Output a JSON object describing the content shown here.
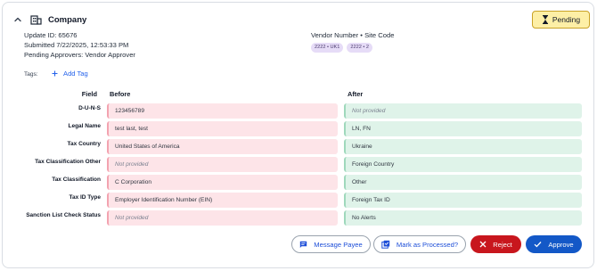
{
  "header": {
    "title": "Company",
    "status": "Pending"
  },
  "meta": {
    "update_id": "Update ID: 65676",
    "submitted": "Submitted 7/22/2025, 12:53:33 PM",
    "pending_approvers": "Pending Approvers: Vendor Approver"
  },
  "vendor": {
    "label": "Vendor Number • Site Code",
    "chips": [
      "2222 • UK1",
      "2222 • 2"
    ]
  },
  "tags": {
    "label": "Tags:",
    "add_label": "Add Tag"
  },
  "table": {
    "headers": {
      "field": "Field",
      "before": "Before",
      "after": "After"
    },
    "rows": [
      {
        "field": "D-U-N-S",
        "before": "123456789",
        "after": "Not provided"
      },
      {
        "field": "Legal Name",
        "before": "test last, test",
        "after": "LN, FN"
      },
      {
        "field": "Tax Country",
        "before": "United States of America",
        "after": "Ukraine"
      },
      {
        "field": "Tax Classification Other",
        "before": "Not provided",
        "after": "Foreign Country"
      },
      {
        "field": "Tax Classification",
        "before": "C Corporation",
        "after": "Other"
      },
      {
        "field": "Tax ID Type",
        "before": "Employer Identification Number (EIN)",
        "after": "Foreign Tax ID"
      },
      {
        "field": "Sanction List Check Status",
        "before": "Not provided",
        "after": "No Alerts"
      }
    ]
  },
  "actions": {
    "message_payee": "Message Payee",
    "mark_processed": "Mark as Processed?",
    "reject": "Reject",
    "approve": "Approve"
  },
  "colors": {
    "accent_blue": "#1358c7",
    "reject_red": "#c8161d",
    "pending_bg": "#fdefa6",
    "before_bg": "#fde4e8",
    "after_bg": "#dff3e9"
  },
  "icons": {
    "collapse": "chevron-up-icon",
    "entity": "building-icon",
    "status": "hourglass-icon",
    "add": "plus-icon",
    "message": "chat-icon",
    "mark": "stacked-check-icon",
    "reject": "close-icon",
    "approve": "check-icon"
  }
}
